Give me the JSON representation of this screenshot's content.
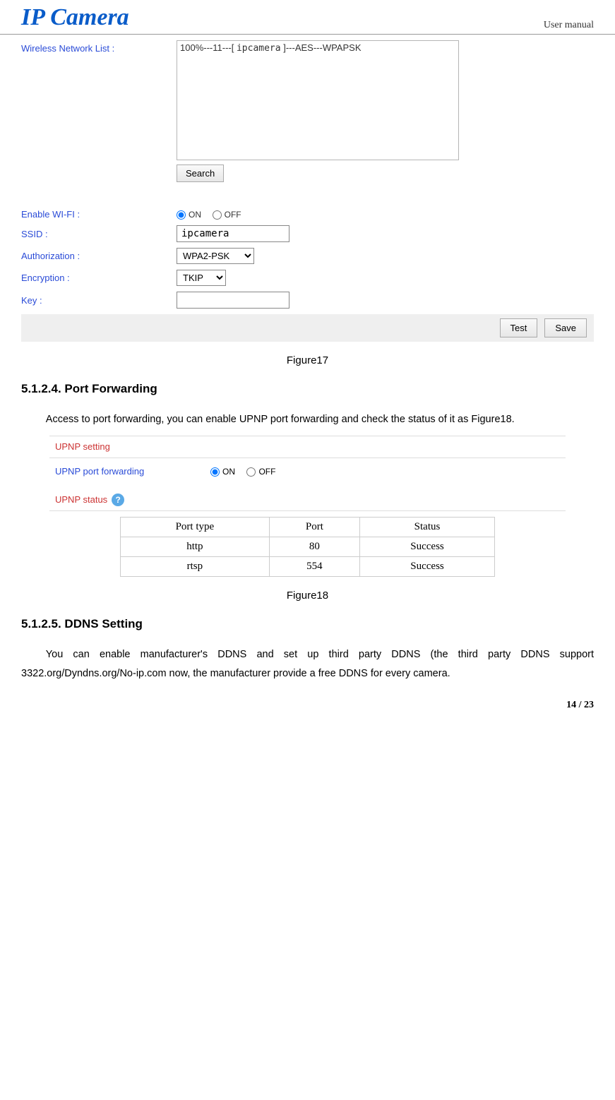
{
  "header": {
    "logo": "IP Camera",
    "user_manual": "User manual"
  },
  "figure17": {
    "labels": {
      "wireless_list": "Wireless Network List :",
      "enable_wifi": "Enable WI-FI :",
      "ssid": "SSID :",
      "authorization": "Authorization :",
      "encryption": "Encryption :",
      "key": "Key :"
    },
    "network_item": {
      "signal": "100%",
      "channel": "11",
      "ssid": "ipcamera",
      "enc": "AES",
      "auth": "WPAPSK"
    },
    "search_btn": "Search",
    "wifi_on": "ON",
    "wifi_off": "OFF",
    "ssid_value": "ipcamera",
    "auth_value": "WPA2-PSK",
    "enc_value": "TKIP",
    "key_value": "",
    "test_btn": "Test",
    "save_btn": "Save",
    "caption": "Figure17"
  },
  "section_5124": {
    "heading": "5.1.2.4. Port Forwarding",
    "body": "Access to port forwarding, you can enable UPNP port forwarding and check the status of it as Figure18."
  },
  "figure18": {
    "upnp_setting_title": "UPNP setting",
    "upnp_port_forwarding_label": "UPNP port forwarding",
    "on": "ON",
    "off": "OFF",
    "upnp_status_title": "UPNP status",
    "table": {
      "headers": [
        "Port type",
        "Port",
        "Status"
      ],
      "rows": [
        [
          "http",
          "80",
          "Success"
        ],
        [
          "rtsp",
          "554",
          "Success"
        ]
      ]
    },
    "caption": "Figure18"
  },
  "section_5125": {
    "heading": "5.1.2.5. DDNS Setting",
    "body": "You can enable manufacturer's DDNS and set up third party DDNS (the third party DDNS support 3322.org/Dyndns.org/No-ip.com now, the manufacturer provide a free DDNS for every camera."
  },
  "page_number": "14 / 23"
}
